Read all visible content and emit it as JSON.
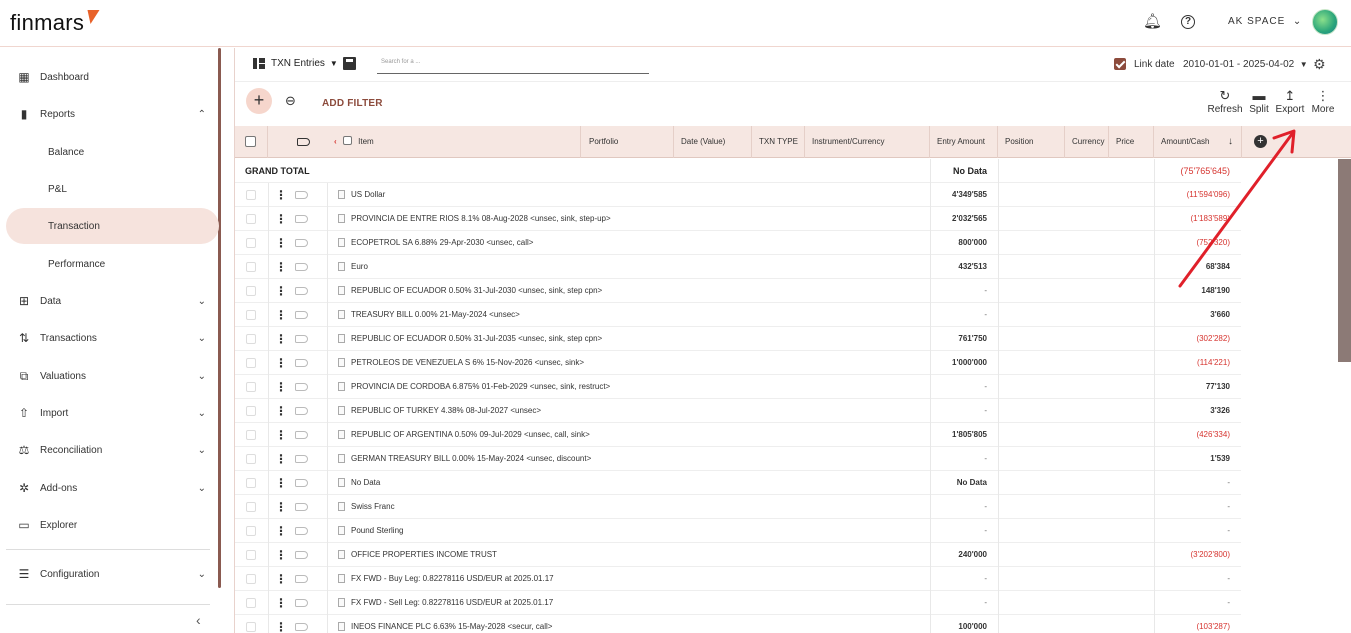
{
  "app": {
    "logo": "finmars",
    "space": "AK SPACE"
  },
  "sidebar": {
    "items": [
      {
        "label": "Dashboard",
        "icon": "dashboard-icon",
        "glyph": "▦"
      },
      {
        "label": "Reports",
        "icon": "bar-chart-icon",
        "glyph": "▮",
        "chevron": "⌃"
      },
      {
        "label": "Data",
        "icon": "data-icon",
        "glyph": "⊞",
        "chevron": "⌄"
      },
      {
        "label": "Transactions",
        "icon": "transactions-icon",
        "glyph": "⇅",
        "chevron": "⌄"
      },
      {
        "label": "Valuations",
        "icon": "valuations-icon",
        "glyph": "⧉",
        "chevron": "⌄"
      },
      {
        "label": "Import",
        "icon": "import-icon",
        "glyph": "⇧",
        "chevron": "⌄"
      },
      {
        "label": "Reconciliation",
        "icon": "scale-icon",
        "glyph": "⚖",
        "chevron": "⌄"
      },
      {
        "label": "Add-ons",
        "icon": "puzzle-icon",
        "glyph": "✲",
        "chevron": "⌄"
      },
      {
        "label": "Explorer",
        "icon": "folder-icon",
        "glyph": "▭"
      },
      {
        "label": "Configuration",
        "icon": "sliders-icon",
        "glyph": "☰",
        "chevron": "⌄"
      }
    ],
    "reports_sub": [
      "Balance",
      "P&L",
      "Transaction",
      "Performance"
    ],
    "active_sub": "Transaction",
    "collapse": "‹"
  },
  "toolbar": {
    "layout_label": "TXN Entries",
    "search_placeholder": "Search for a ...",
    "link_date_label": "Link date",
    "date_range": "2010-01-01 - 2025-04-02",
    "add_filter": "ADD FILTER",
    "actions": [
      {
        "label": "Refresh",
        "glyph": "↻"
      },
      {
        "label": "Split",
        "glyph": "▬"
      },
      {
        "label": "Export",
        "glyph": "↥"
      },
      {
        "label": "More",
        "glyph": "⋮"
      }
    ]
  },
  "table": {
    "columns": [
      "Item",
      "Portfolio",
      "Date (Value)",
      "TXN TYPE",
      "Instrument/Currency",
      "Entry Amount",
      "Position",
      "Currency",
      "Price",
      "Amount/Cash"
    ],
    "grand_total": {
      "label": "GRAND TOTAL",
      "entry_amount": "No Data",
      "amount_cash": "(75'765'645)"
    },
    "rows": [
      {
        "item": "US Dollar",
        "entry": "4'349'585",
        "cash": "(11'594'096)"
      },
      {
        "item": "PROVINCIA DE ENTRE RIOS  8.1%  08-Aug-2028  <unsec, sink, step-up>",
        "entry": "2'032'565",
        "cash": "(1'183'589)"
      },
      {
        "item": "ECOPETROL SA  6.88%  29-Apr-2030  <unsec, call>",
        "entry": "800'000",
        "cash": "(752'320)"
      },
      {
        "item": "Euro",
        "entry": "432'513",
        "cash": "68'384"
      },
      {
        "item": "REPUBLIC OF ECUADOR  0.50%  31-Jul-2030  <unsec, sink, step cpn>",
        "entry": "-",
        "cash": "148'190"
      },
      {
        "item": "TREASURY BILL  0.00%  21-May-2024  <unsec>",
        "entry": "-",
        "cash": "3'660"
      },
      {
        "item": "REPUBLIC OF ECUADOR  0.50%  31-Jul-2035  <unsec, sink, step cpn>",
        "entry": "761'750",
        "cash": "(302'282)"
      },
      {
        "item": "PETROLEOS DE VENEZUELA S  6%  15-Nov-2026  <unsec, sink>",
        "entry": "1'000'000",
        "cash": "(114'221)"
      },
      {
        "item": "PROVINCIA DE CORDOBA  6.875%  01-Feb-2029  <unsec, sink, restruct>",
        "entry": "-",
        "cash": "77'130"
      },
      {
        "item": "REPUBLIC OF TURKEY  4.38%  08-Jul-2027  <unsec>",
        "entry": "-",
        "cash": "3'326"
      },
      {
        "item": "REPUBLIC OF ARGENTINA  0.50%  09-Jul-2029  <unsec, call, sink>",
        "entry": "1'805'805",
        "cash": "(426'334)"
      },
      {
        "item": "GERMAN TREASURY BILL  0.00%  15-May-2024  <unsec, discount>",
        "entry": "-",
        "cash": "1'539"
      },
      {
        "item": "No Data",
        "entry": "No Data",
        "cash": "-"
      },
      {
        "item": "Swiss Franc",
        "entry": "-",
        "cash": "-"
      },
      {
        "item": "Pound Sterling",
        "entry": "-",
        "cash": "-"
      },
      {
        "item": "OFFICE PROPERTIES INCOME TRUST",
        "entry": "240'000",
        "cash": "(3'202'800)"
      },
      {
        "item": "FX FWD - Buy Leg: 0.82278116 USD/EUR at 2025.01.17",
        "entry": "-",
        "cash": "-"
      },
      {
        "item": "FX FWD - Sell Leg: 0.82278116 USD/EUR at 2025.01.17",
        "entry": "-",
        "cash": "-"
      },
      {
        "item": "INEOS FINANCE PLC  6.63%  15-May-2028  <secur, call>",
        "entry": "100'000",
        "cash": "(103'287)"
      }
    ]
  },
  "colors": {
    "accent": "#8c4b3c",
    "negative": "#d6342f",
    "highlight": "#f6e3dd",
    "arrow": "#e0202a"
  }
}
